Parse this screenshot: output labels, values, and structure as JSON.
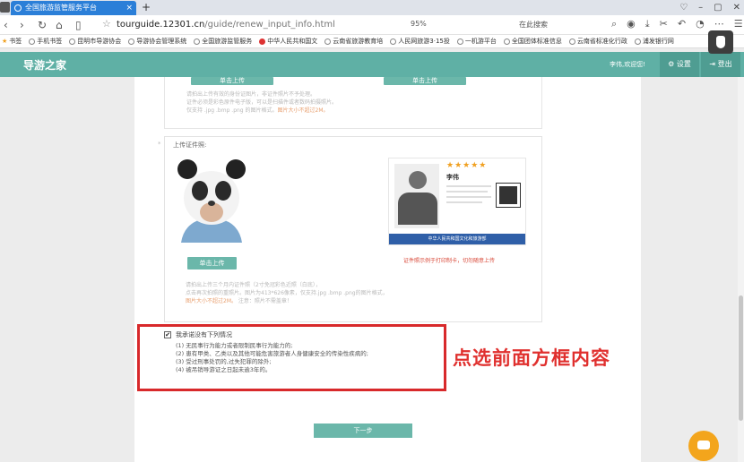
{
  "browser": {
    "tab_title": "全国旅游监管服务平台",
    "tab_close": "×",
    "tab_add": "+",
    "url_host": "tourguide.12301.cn",
    "url_path": "/guide/renew_input_info.html",
    "zoom": "95%",
    "search_placeholder": "在此搜索",
    "nav": {
      "back": "‹",
      "forward": "›",
      "reload": "↻",
      "home": "⌂",
      "reader": "▯"
    },
    "window_controls": [
      "♡",
      "–",
      "▢",
      "✕"
    ],
    "bookmarks": [
      "书签",
      "手机书签",
      "昆明市导游协会",
      "导游协会管理系统",
      "全国旅游监管服务",
      "中华人民共和国文",
      "云南省旅游教育培",
      "人民网旅游3·15投",
      "一机游平台",
      "全国团体标准信息",
      "云南省标准化行政",
      "浦发银行网"
    ]
  },
  "site": {
    "title": "导游之家",
    "welcome": "李伟,欢迎您!",
    "settings": "设置",
    "logout": "登出"
  },
  "upload_top": {
    "buttons": [
      "单击上传",
      "单击上传"
    ],
    "notes": [
      "请拍出上传有效的身份证图片，非证件照片不予处理。",
      "证件必须是彩色原件电子版，可以是扫描件或者数码拍摄照片。",
      "仅支持 .jpg .bmp .png 的图片格式。"
    ],
    "warn": "图片大小不超过2M。"
  },
  "upload_photo": {
    "label": "上传证件照:",
    "button": "单击上传",
    "notes": [
      "请拍出上传三个月内证件照（2寸免冠彩色近照（白底），",
      "点击再次拍照的重照片。图片为413*626像素，仅支持.jpg .bmp .png的图片格式，"
    ],
    "warn": "图片大小不超过2M。",
    "warn_tail": "注意：照片不需盖章！",
    "sample_caption": "证件照示例于打印制卡，切勿随意上传",
    "sample_stars": "★★★★★",
    "sample_name": "李伟",
    "sample_footer": "中华人民共和国文化和旅游部"
  },
  "declaration": {
    "checkbox_title": "我承诺没有下列情况",
    "checked": true,
    "items": [
      "(1) 无民事行为能力或者限制民事行为能力的;",
      "(2) 患有甲类、乙类以及其他可能危害旅游者人身健康安全的传染性疾病的;",
      "(3) 受过刑事处罚的,过失犯罪的除外;",
      "(4) 被吊销导游证之日起未逾3年的。"
    ]
  },
  "annotation": "点选前面方框内容",
  "next_button": "下一步",
  "colors": {
    "accent": "#6bb7aa",
    "header": "#5fb0a5",
    "annotation": "#d8292b",
    "tab": "#2b7fd8"
  }
}
